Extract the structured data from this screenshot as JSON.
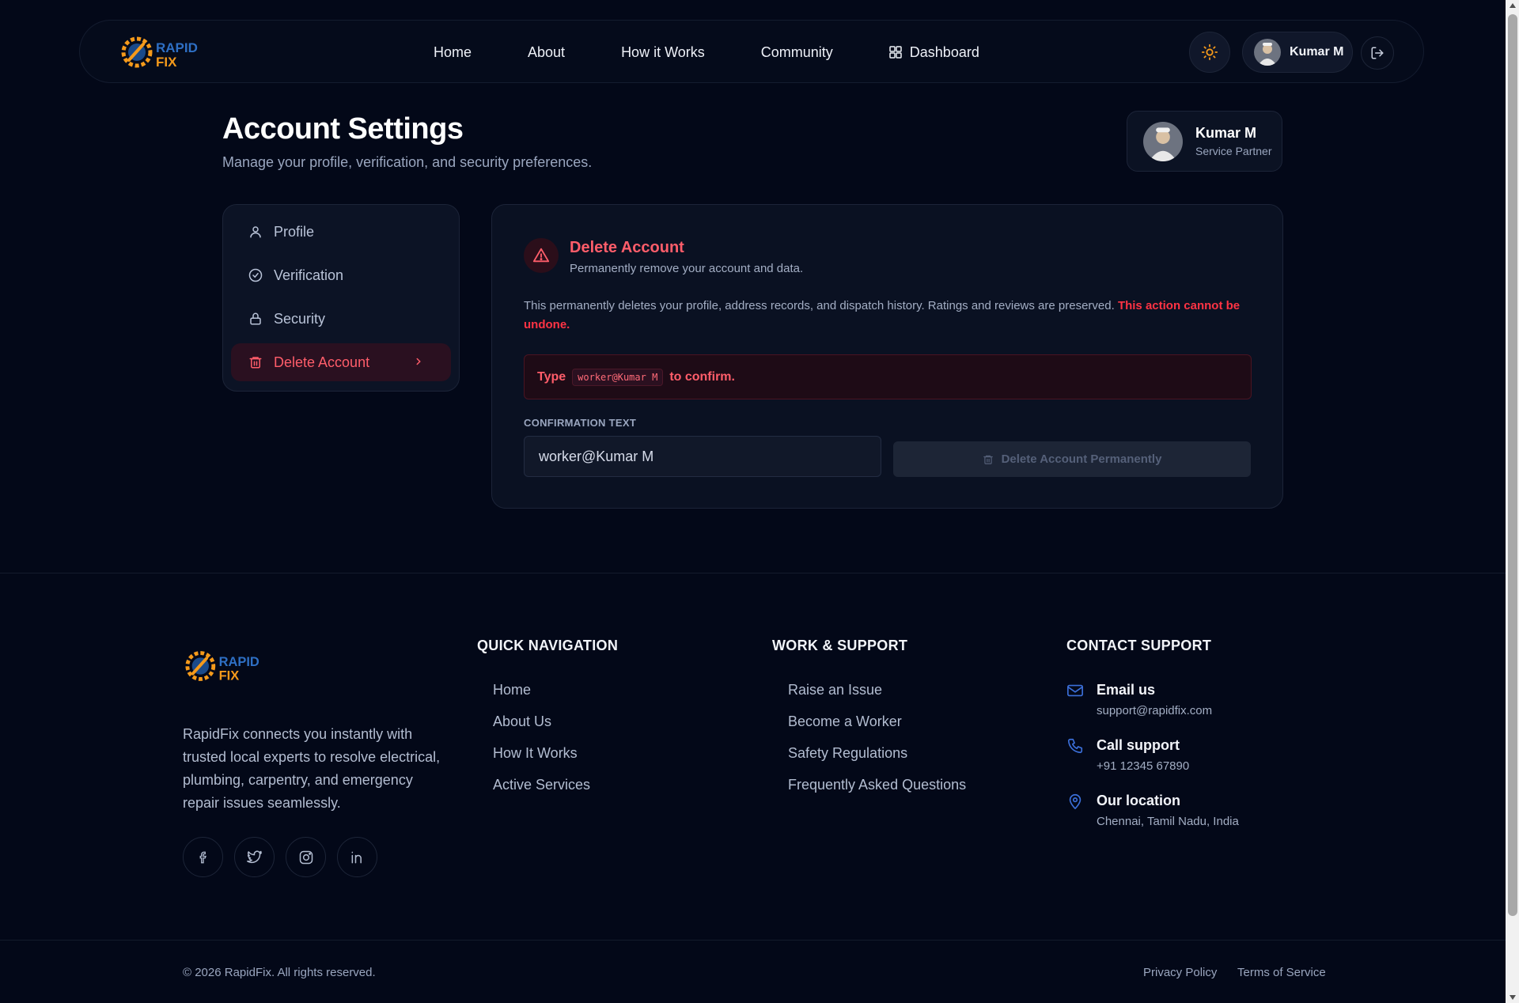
{
  "brand": {
    "logo_top": "RAPID",
    "logo_bottom": "FIX"
  },
  "header": {
    "nav": [
      "Home",
      "About",
      "How it Works",
      "Community",
      "Dashboard"
    ],
    "user_name": "Kumar M"
  },
  "page": {
    "title": "Account Settings",
    "subtitle": "Manage your profile, verification, and security preferences."
  },
  "profile_card": {
    "name": "Kumar M",
    "role": "Service Partner"
  },
  "sidebar": {
    "items": [
      {
        "label": "Profile",
        "icon": "user-icon"
      },
      {
        "label": "Verification",
        "icon": "check-circle-icon"
      },
      {
        "label": "Security",
        "icon": "lock-icon"
      },
      {
        "label": "Delete Account",
        "icon": "trash-icon",
        "active": true
      }
    ]
  },
  "delete_card": {
    "title": "Delete Account",
    "subtitle": "Permanently remove your account and data.",
    "description": "This permanently deletes your profile, address records, and dispatch history. Ratings and reviews are preserved.",
    "warning": "This action cannot be undone.",
    "confirm_prefix": "Type",
    "confirm_code": "worker@Kumar M",
    "confirm_suffix": "to confirm.",
    "field_label": "CONFIRMATION TEXT",
    "field_value": "worker@Kumar M",
    "button_label": "Delete Account Permanently"
  },
  "footer": {
    "about": "RapidFix connects you instantly with trusted local experts to resolve electrical, plumbing, carpentry, and emergency repair issues seamlessly.",
    "quick_nav": {
      "title": "QUICK NAVIGATION",
      "items": [
        "Home",
        "About Us",
        "How It Works",
        "Active Services"
      ]
    },
    "work_support": {
      "title": "WORK & SUPPORT",
      "items": [
        "Raise an Issue",
        "Become a Worker",
        "Safety Regulations",
        "Frequently Asked Questions"
      ]
    },
    "contact": {
      "title": "CONTACT SUPPORT",
      "items": [
        {
          "label": "Email us",
          "value": "support@rapidfix.com",
          "icon": "mail-icon"
        },
        {
          "label": "Call support",
          "value": "+91 12345 67890",
          "icon": "phone-icon"
        },
        {
          "label": "Our location",
          "value": "Chennai, Tamil Nadu, India",
          "icon": "map-pin-icon"
        }
      ]
    },
    "copyright": "© 2026 RapidFix. All rights reserved.",
    "privacy": "Privacy Policy",
    "terms": "Terms of Service"
  },
  "colors": {
    "background": "#030818",
    "danger": "#ff5d6a",
    "accent": "#f59a1b"
  }
}
